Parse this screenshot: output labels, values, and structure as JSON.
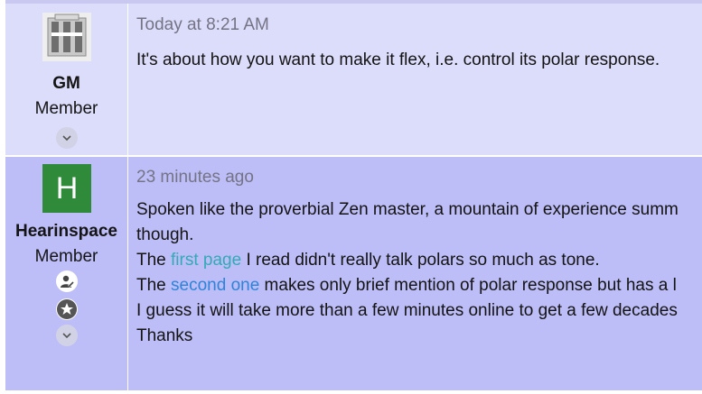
{
  "posts": [
    {
      "author": "GM",
      "title": "Member",
      "date": "Today at 8:21 AM",
      "body": "It's about how you want to make it flex, i.e. control its polar response."
    },
    {
      "author": "Hearinspace",
      "title": "Member",
      "avatar_letter": "H",
      "date": "23 minutes ago",
      "lines": {
        "l1": "Spoken like the proverbial Zen master, a mountain of experience summ",
        "l2": "though.",
        "l3_pre": "The ",
        "l3_link": "first page",
        "l3_post": " I read didn't really talk polars so much as tone.",
        "l4_pre": "The ",
        "l4_link": "second one",
        "l4_post": " makes only brief mention of polar response but has a l",
        "l5": "I guess it will take more than a few minutes online to get a few decades",
        "l6": "Thanks"
      }
    }
  ],
  "colors": {
    "post1_bg": "#dcdcfb",
    "post2_bg": "#bdbdf8",
    "link1": "#35a9b4",
    "link2": "#2f83d9",
    "avatar_bg": "#2f8a3a"
  },
  "icons": [
    "chevron-down-icon",
    "user-edit-icon",
    "star-icon"
  ]
}
